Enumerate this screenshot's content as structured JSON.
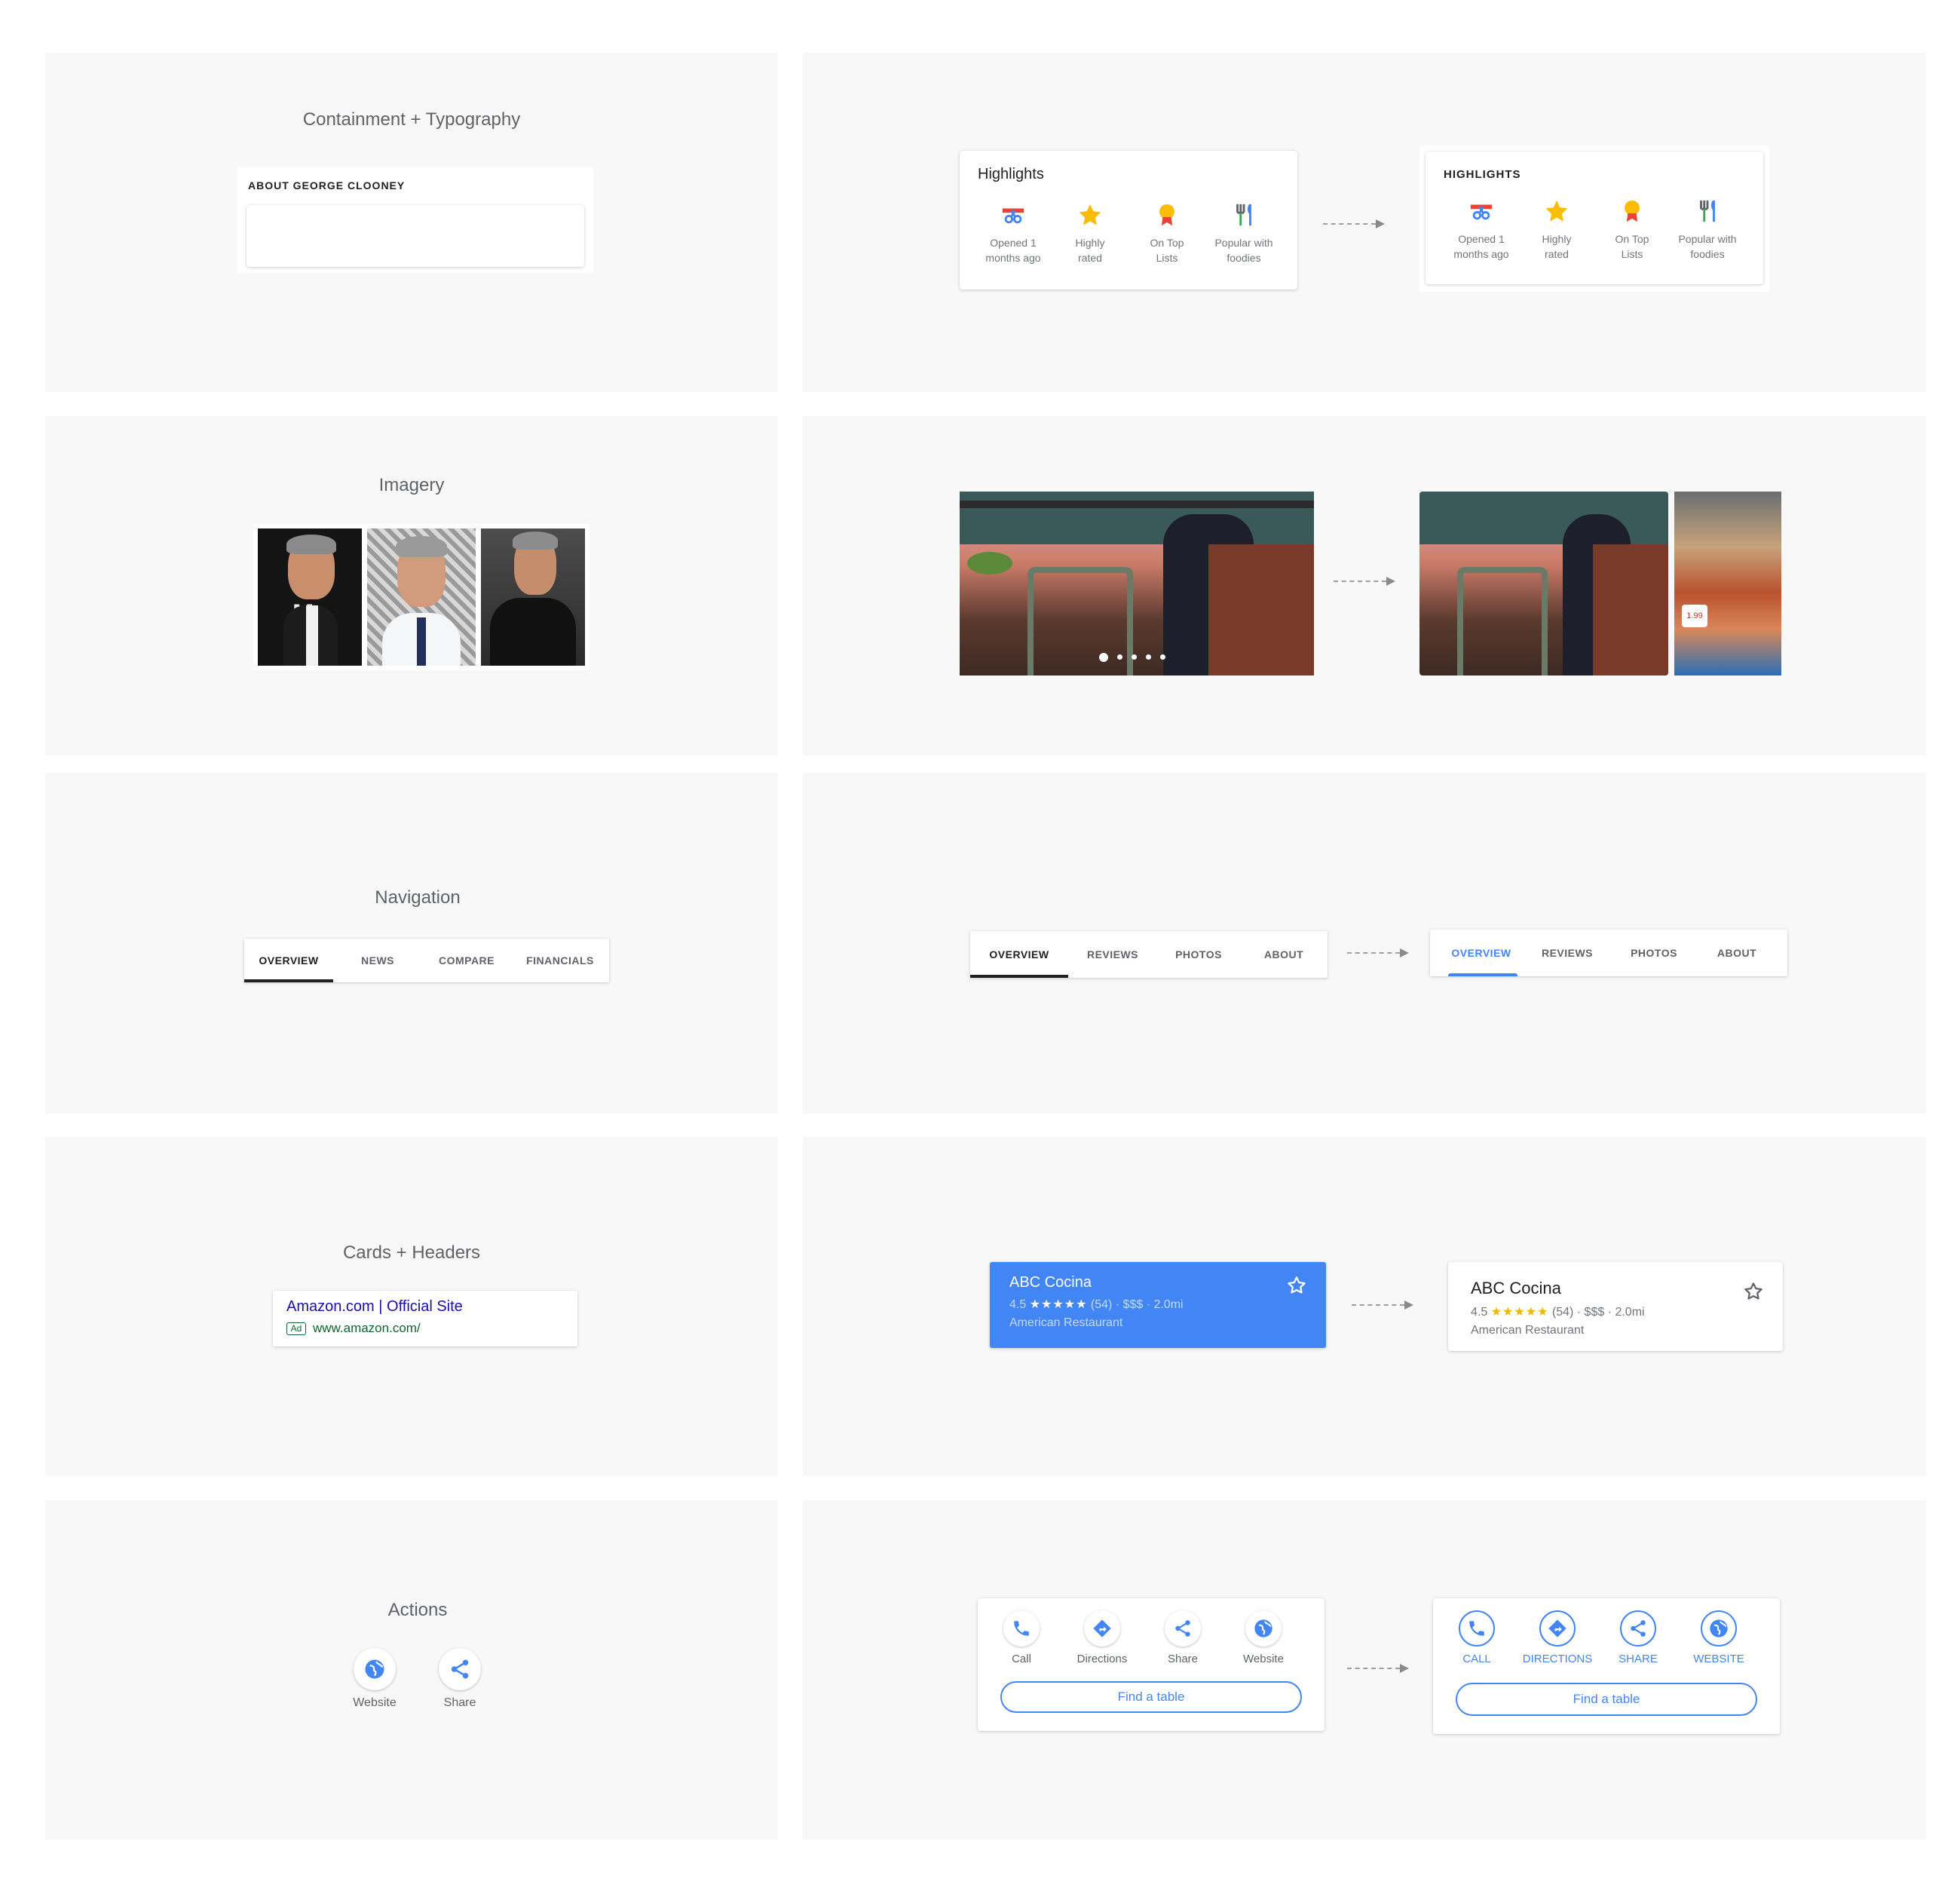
{
  "sections": {
    "containment": {
      "title": "Containment + Typography",
      "card_header": "ABOUT GEORGE CLOONEY"
    },
    "imagery": {
      "title": "Imagery"
    },
    "navigation": {
      "title": "Navigation",
      "tabs": [
        "OVERVIEW",
        "NEWS",
        "COMPARE",
        "FINANCIALS"
      ]
    },
    "cards": {
      "title": "Cards + Headers",
      "ad_title": "Amazon.com | Official Site",
      "ad_badge": "Ad",
      "ad_url": "www.amazon.com/"
    },
    "actions": {
      "title": "Actions",
      "items": [
        "Website",
        "Share"
      ]
    }
  },
  "highlights": {
    "before_title": "Highlights",
    "after_title": "HIGHLIGHTS",
    "items": [
      {
        "line1": "Opened 1",
        "line2": "months ago",
        "icon": "ribbon-cut-icon"
      },
      {
        "line1": "Highly",
        "line2": "rated",
        "icon": "star-icon"
      },
      {
        "line1": "On Top",
        "line2": "Lists",
        "icon": "award-medal-icon"
      },
      {
        "line1": "Popular with",
        "line2": "foodies",
        "icon": "utensils-icon"
      }
    ]
  },
  "place_tabs": [
    "OVERVIEW",
    "REVIEWS",
    "PHOTOS",
    "ABOUT"
  ],
  "place_card": {
    "name": "ABC Cocina",
    "rating": "4.5",
    "stars": "★★★★★",
    "reviews": "(54) · $$$ · 2.0mi",
    "category": "American Restaurant"
  },
  "place_actions": {
    "before": [
      "Call",
      "Directions",
      "Share",
      "Website"
    ],
    "after": [
      "CALL",
      "DIRECTIONS",
      "SHARE",
      "WEBSITE"
    ],
    "cta": "Find a table"
  },
  "colors": {
    "accent": "#4285f4",
    "panel": "#f8f8f8",
    "ad_green": "#0d652d",
    "link_blue": "#1a0dab"
  }
}
